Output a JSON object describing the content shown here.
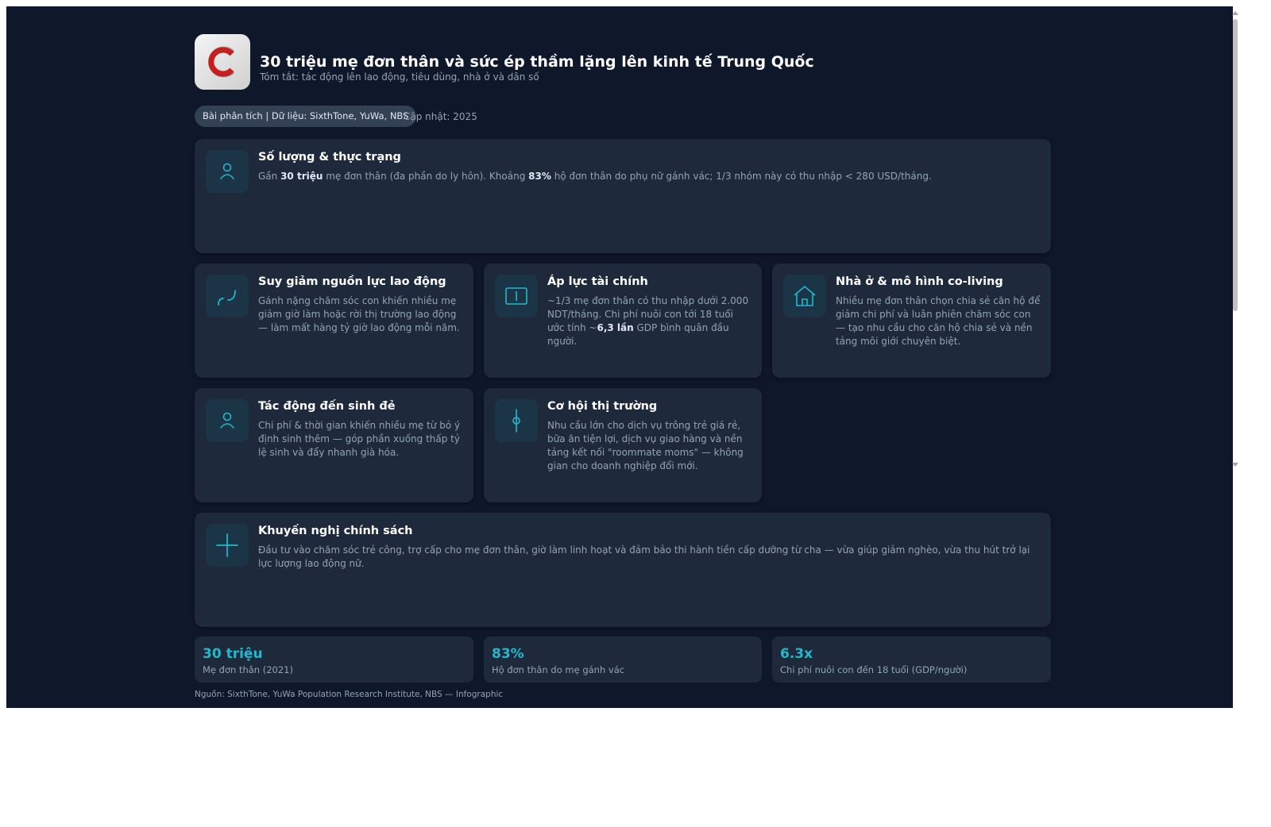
{
  "header": {
    "logo_icon": "c-logo-icon",
    "title": "30 triệu mẹ đơn thân và sức ép thầm lặng lên kinh tế Trung Quốc",
    "subtitle": "Tóm tắt: tác động lên lao động, tiêu dùng, nhà ở và dân số"
  },
  "meta": {
    "badge": "Bài phân tích | Dữ liệu: SixthTone, YuWa, NBS",
    "updated": "Cập nhật: 2025"
  },
  "cards": {
    "count": {
      "icon": "person-icon",
      "title": "Số lượng & thực trạng",
      "body_parts": [
        "Gần ",
        "30 triệu",
        " mẹ đơn thân (đa phần do ly hôn). Khoảng ",
        "83%",
        " hộ đơn thân do phụ nữ gánh vác; 1/3 nhóm này có thu nhập < 280 USD/tháng."
      ]
    },
    "labor": {
      "icon": "curve-icon",
      "title": "Suy giảm nguồn lực lao động",
      "body": "Gánh nặng chăm sóc con khiến nhiều mẹ giảm giờ làm hoặc rời thị trường lao động — làm mất hàng tỷ giờ lao động mỗi năm."
    },
    "finance": {
      "icon": "wallet-icon",
      "title": "Áp lực tài chính",
      "body_parts": [
        "~1/3 mẹ đơn thân có thu nhập dưới 2.000 NDT/tháng. Chi phí nuôi con tới 18 tuổi ước tính ~",
        "6,3 lần",
        " GDP bình quân đầu người."
      ]
    },
    "housing": {
      "icon": "house-icon",
      "title": "Nhà ở & mô hình co-living",
      "body": "Nhiều mẹ đơn thân chọn chia sẻ căn hộ để giảm chi phí và luân phiên chăm sóc con — tạo nhu cầu cho căn hộ chia sẻ và nền tảng môi giới chuyên biệt."
    },
    "birth": {
      "icon": "person-icon",
      "title": "Tác động đến sinh đẻ",
      "body": "Chi phí & thời gian khiến nhiều mẹ từ bỏ ý định sinh thêm — góp phần xuống thấp tỷ lệ sinh và đẩy nhanh già hóa."
    },
    "market": {
      "icon": "pin-icon",
      "title": "Cơ hội thị trường",
      "body": "Nhu cầu lớn cho dịch vụ trông trẻ giá rẻ, bữa ăn tiện lợi, dịch vụ giao hàng và nền tảng kết nối \"roommate moms\" — không gian cho doanh nghiệp đổi mới."
    },
    "policy": {
      "icon": "cross-icon",
      "title": "Khuyến nghị chính sách",
      "body": "Đầu tư vào chăm sóc trẻ công, trợ cấp cho mẹ đơn thân, giờ làm linh hoạt và đảm bảo thi hành tiền cấp dưỡng từ cha — vừa giúp giảm nghèo, vừa thu hút trở lại lực lượng lao động nữ."
    }
  },
  "stats": [
    {
      "value": "30 triệu",
      "label": "Mẹ đơn thân (2021)"
    },
    {
      "value": "83%",
      "label": "Hộ đơn thân do mẹ gánh vác"
    },
    {
      "value": "6.3x",
      "label": "Chi phí nuôi con đến 18 tuổi (GDP/người)"
    }
  ],
  "footer": "Nguồn: SixthTone, YuWa Population Research Institute, NBS — Infographic",
  "colors": {
    "background": "#0f172a",
    "card": "#1e293b",
    "accent": "#22b8cf",
    "muted_text": "#94a3b8",
    "logo_red": "#c81e1e"
  }
}
